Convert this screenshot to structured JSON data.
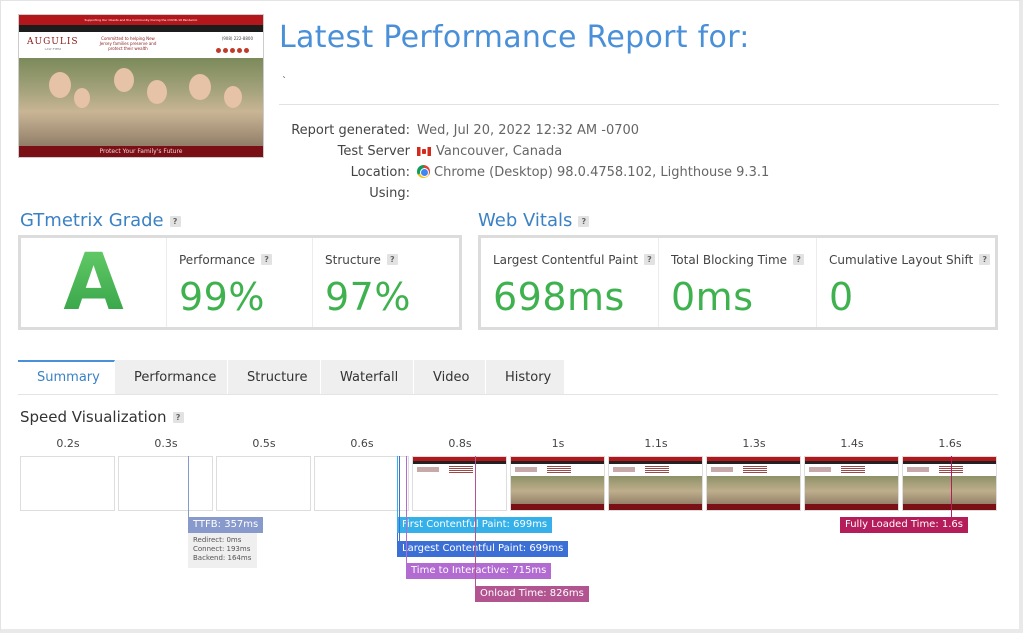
{
  "thumbnail": {
    "topbar_text": "Supporting Our Clients and the Community During the COVID-19 Pandemic",
    "logo": "AUGULIS",
    "logo_sub": "LAW FIRM",
    "tagline": "Committed to helping New Jersey families preserve and protect their wealth",
    "phone": "(908) 222-8800",
    "banner_text": "Protect Your Family's Future"
  },
  "report": {
    "title": "Latest Performance Report for:",
    "subtitle": "`",
    "labels": [
      "Report generated:",
      "Test Server Location:",
      "Using:"
    ],
    "generated": "Wed, Jul 20, 2022 12:32 AM -0700",
    "location": "Vancouver, Canada",
    "using": "Chrome (Desktop) 98.0.4758.102, Lighthouse 9.3.1"
  },
  "grade": {
    "heading": "GTmetrix Grade",
    "letter": "A",
    "performance_label": "Performance",
    "performance_value": "99%",
    "structure_label": "Structure",
    "structure_value": "97%",
    "grade_color": "#3fb24f"
  },
  "vitals": {
    "heading": "Web Vitals",
    "lcp_label": "Largest Contentful Paint",
    "lcp_value": "698ms",
    "tbt_label": "Total Blocking Time",
    "tbt_value": "0ms",
    "cls_label": "Cumulative Layout Shift",
    "cls_value": "0"
  },
  "tabs": [
    "Summary",
    "Performance",
    "Structure",
    "Waterfall",
    "Video",
    "History"
  ],
  "active_tab": "Summary",
  "speed": {
    "heading": "Speed Visualization",
    "times": [
      "0.2s",
      "0.3s",
      "0.5s",
      "0.6s",
      "0.8s",
      "1s",
      "1.1s",
      "1.3s",
      "1.4s",
      "1.6s"
    ],
    "ttfb": "TTFB: 357ms",
    "ttfb_details": [
      "Redirect: 0ms",
      "Connect: 193ms",
      "Backend: 164ms"
    ],
    "fcp": "First Contentful Paint: 699ms",
    "lcp": "Largest Contentful Paint: 699ms",
    "tti": "Time to Interactive: 715ms",
    "onload": "Onload Time: 826ms",
    "fully_loaded": "Fully Loaded Time: 1.6s",
    "colors": {
      "ttfb": "#8899cc",
      "fcp": "#35b0e8",
      "lcp": "#3c6fd6",
      "tti": "#b26bd1",
      "onload": "#b2548f",
      "fully_loaded": "#b51d5a"
    }
  }
}
